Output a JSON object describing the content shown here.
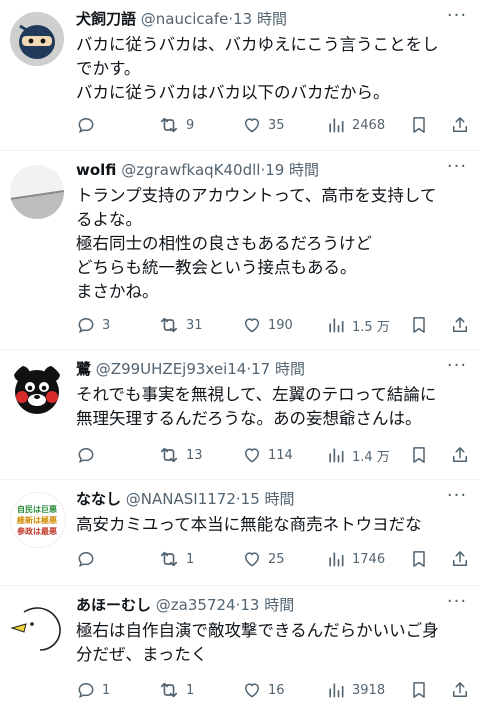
{
  "tweets": [
    {
      "name": "犬飼刀語",
      "handle": "@naucicafe",
      "time": "·13 時間",
      "lines": [
        "バカに従うバカは、バカゆえにこう言うことをし",
        "でかす。",
        "バカに従うバカはバカ以下のバカだから。"
      ],
      "replies": "",
      "retweets": "9",
      "likes": "35",
      "views": "2468",
      "avatar_icon": "ninja-avatar-icon"
    },
    {
      "name": "wolfi",
      "handle": "@zgrawfkaqK40dll",
      "time": "·19 時間",
      "lines": [
        "トランプ支持のアカウントって、高市を支持して",
        "るよな。",
        "極右同士の相性の良さもあるだろうけど",
        "どちらも統一教会という接点もある。",
        "まさかね。"
      ],
      "replies": "3",
      "retweets": "31",
      "likes": "190",
      "views": "1.5 万",
      "avatar_icon": "paper-avatar-icon"
    },
    {
      "name": "鷺",
      "handle": "@Z99UHZEj93xei14",
      "time": "·17 時間",
      "lines": [
        "それでも事実を無視して、左翼のテロって結論に",
        "無理矢理するんだろうな。あの妄想爺さんは。"
      ],
      "replies": "",
      "retweets": "13",
      "likes": "114",
      "views": "1.4 万",
      "avatar_icon": "bear-avatar-icon"
    },
    {
      "name": "ななし",
      "handle": "@NANASI1172",
      "time": "·15 時間",
      "lines": [
        "高安カミユって本当に無能な商売ネトウヨだな"
      ],
      "replies": "",
      "retweets": "1",
      "likes": "25",
      "views": "1746",
      "avatar_icon": "text-avatar-icon",
      "avatar_text": [
        "自民は巨悪",
        "維新は極悪",
        "参政は最悪"
      ]
    },
    {
      "name": "あほーむし",
      "handle": "@za35724",
      "time": "·13 時間",
      "lines": [
        "極右は自作自演で敵攻撃できるんだらかいいご身",
        "分だぜ、まったく"
      ],
      "replies": "1",
      "retweets": "1",
      "likes": "16",
      "views": "3918",
      "avatar_icon": "bird-avatar-icon"
    }
  ],
  "colors": {
    "text": "#0f1419",
    "muted": "#536471",
    "divider": "#eff3f4"
  }
}
